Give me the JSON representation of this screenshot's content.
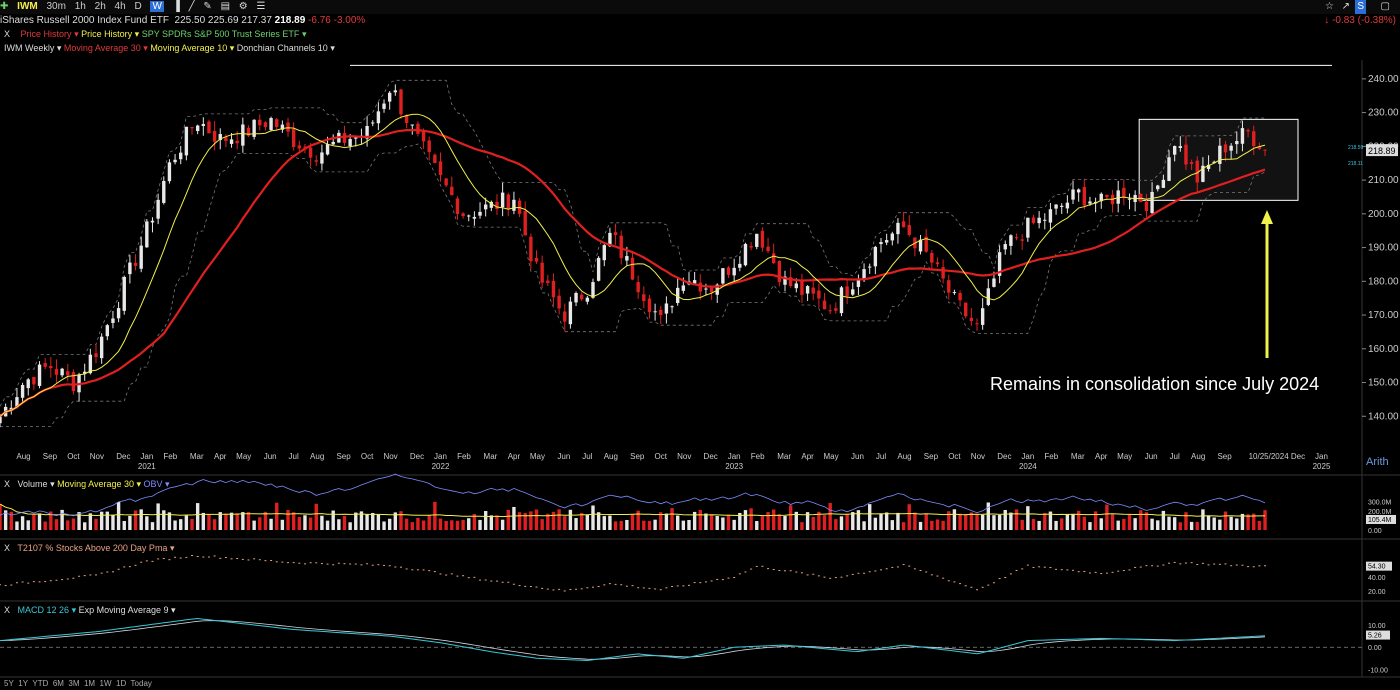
{
  "header": {
    "symbol": "IWM",
    "timeframes": [
      "30m",
      "1h",
      "2h",
      "4h",
      "D",
      "W"
    ],
    "active_timeframe": "W",
    "change_right": "-0.83 (-0.38%)",
    "name": "iShares Russell 2000 Index Fund ETF",
    "open": "225.50",
    "high": "225.69",
    "low": "217.37",
    "close": "218.89",
    "change": "-6.76",
    "change_pct": "-3.00%"
  },
  "overlays_row": {
    "close_x": "X",
    "price_history_1": "Price History",
    "price_history_2": "Price History",
    "compare": "SPY SPDRs S&P 500 Trust Series ETF"
  },
  "studies_row": {
    "weekly": "IWM Weekly",
    "ma30": "Moving Average 30",
    "ma10": "Moving Average 10",
    "donchian": "Donchian Channels 10"
  },
  "annotation": "Remains in consolidation since July 2024",
  "volume_pane": {
    "close_x": "X",
    "label": "Volume",
    "ma": "Moving Average 30",
    "obv": "OBV",
    "ticks": [
      "300.0M",
      "200.0M",
      "0.00"
    ],
    "last": "105.4M"
  },
  "breadth_pane": {
    "close_x": "X",
    "label": "T2107 % Stocks Above 200 Day Pma",
    "ticks": [
      "40.00",
      "20.00"
    ],
    "last": "54.30"
  },
  "macd_pane": {
    "close_x": "X",
    "label": "MACD 12 26",
    "signal": "Exp Moving Average 9",
    "ticks": [
      "10.00",
      "0.00",
      "-10.00"
    ],
    "last": "5.26"
  },
  "footer": {
    "ranges": [
      "5Y",
      "1Y",
      "YTD",
      "6M",
      "3M",
      "1M",
      "1W",
      "1D",
      "Today"
    ]
  },
  "scale_mode": "Arith",
  "colors": {
    "up": "#e8e8e8",
    "down": "#e02020",
    "ma30": "#e02020",
    "ma10": "#f2f04a",
    "donchian": "#777777",
    "obv": "#7d8cff",
    "breadth": "#e8a080",
    "macd": "#38c8d8",
    "signal": "#cfd8e0",
    "annotation_arrow": "#f2f04a"
  },
  "chart_data": [
    {
      "type": "candlestick",
      "series_name": "IWM Weekly",
      "ylim": [
        130,
        245
      ],
      "y_ticks": [
        140,
        150,
        160,
        170,
        180,
        190,
        200,
        210,
        220,
        230,
        240
      ],
      "x_labels": [
        {
          "label": "Aug",
          "year": "",
          "t": 2020.58
        },
        {
          "label": "Sep",
          "year": "",
          "t": 2020.67
        },
        {
          "label": "Oct",
          "year": "",
          "t": 2020.75
        },
        {
          "label": "Nov",
          "year": "",
          "t": 2020.83
        },
        {
          "label": "Dec",
          "year": "",
          "t": 2020.92
        },
        {
          "label": "Jan",
          "year": "2021",
          "t": 2021.0
        },
        {
          "label": "Feb",
          "year": "",
          "t": 2021.08
        },
        {
          "label": "Mar",
          "year": "",
          "t": 2021.17
        },
        {
          "label": "Apr",
          "year": "",
          "t": 2021.25
        },
        {
          "label": "May",
          "year": "",
          "t": 2021.33
        },
        {
          "label": "Jun",
          "year": "",
          "t": 2021.42
        },
        {
          "label": "Jul",
          "year": "",
          "t": 2021.5
        },
        {
          "label": "Aug",
          "year": "",
          "t": 2021.58
        },
        {
          "label": "Sep",
          "year": "",
          "t": 2021.67
        },
        {
          "label": "Oct",
          "year": "",
          "t": 2021.75
        },
        {
          "label": "Nov",
          "year": "",
          "t": 2021.83
        },
        {
          "label": "Dec",
          "year": "",
          "t": 2021.92
        },
        {
          "label": "Jan",
          "year": "2022",
          "t": 2022.0
        },
        {
          "label": "Feb",
          "year": "",
          "t": 2022.08
        },
        {
          "label": "Mar",
          "year": "",
          "t": 2022.17
        },
        {
          "label": "Apr",
          "year": "",
          "t": 2022.25
        },
        {
          "label": "May",
          "year": "",
          "t": 2022.33
        },
        {
          "label": "Jun",
          "year": "",
          "t": 2022.42
        },
        {
          "label": "Jul",
          "year": "",
          "t": 2022.5
        },
        {
          "label": "Aug",
          "year": "",
          "t": 2022.58
        },
        {
          "label": "Sep",
          "year": "",
          "t": 2022.67
        },
        {
          "label": "Oct",
          "year": "",
          "t": 2022.75
        },
        {
          "label": "Nov",
          "year": "",
          "t": 2022.83
        },
        {
          "label": "Dec",
          "year": "",
          "t": 2022.92
        },
        {
          "label": "Jan",
          "year": "2023",
          "t": 2023.0
        },
        {
          "label": "Feb",
          "year": "",
          "t": 2023.08
        },
        {
          "label": "Mar",
          "year": "",
          "t": 2023.17
        },
        {
          "label": "Apr",
          "year": "",
          "t": 2023.25
        },
        {
          "label": "May",
          "year": "",
          "t": 2023.33
        },
        {
          "label": "Jun",
          "year": "",
          "t": 2023.42
        },
        {
          "label": "Jul",
          "year": "",
          "t": 2023.5
        },
        {
          "label": "Aug",
          "year": "",
          "t": 2023.58
        },
        {
          "label": "Sep",
          "year": "",
          "t": 2023.67
        },
        {
          "label": "Oct",
          "year": "",
          "t": 2023.75
        },
        {
          "label": "Nov",
          "year": "",
          "t": 2023.83
        },
        {
          "label": "Dec",
          "year": "",
          "t": 2023.92
        },
        {
          "label": "Jan",
          "year": "2024",
          "t": 2024.0
        },
        {
          "label": "Feb",
          "year": "",
          "t": 2024.08
        },
        {
          "label": "Mar",
          "year": "",
          "t": 2024.17
        },
        {
          "label": "Apr",
          "year": "",
          "t": 2024.25
        },
        {
          "label": "May",
          "year": "",
          "t": 2024.33
        },
        {
          "label": "Jun",
          "year": "",
          "t": 2024.42
        },
        {
          "label": "Jul",
          "year": "",
          "t": 2024.5
        },
        {
          "label": "Aug",
          "year": "",
          "t": 2024.58
        },
        {
          "label": "Sep",
          "year": "",
          "t": 2024.67
        },
        {
          "label": "10/25/2024",
          "year": "",
          "t": 2024.82
        },
        {
          "label": "Dec",
          "year": "",
          "t": 2024.92
        },
        {
          "label": "Jan",
          "year": "2025",
          "t": 2025.0
        }
      ],
      "key_points": [
        {
          "t": 2020.5,
          "p": 140
        },
        {
          "t": 2020.58,
          "p": 150
        },
        {
          "t": 2020.67,
          "p": 155
        },
        {
          "t": 2020.75,
          "p": 150
        },
        {
          "t": 2020.83,
          "p": 160
        },
        {
          "t": 2020.92,
          "p": 178
        },
        {
          "t": 2021.0,
          "p": 195
        },
        {
          "t": 2021.08,
          "p": 215
        },
        {
          "t": 2021.17,
          "p": 228
        },
        {
          "t": 2021.25,
          "p": 222
        },
        {
          "t": 2021.33,
          "p": 224
        },
        {
          "t": 2021.42,
          "p": 228
        },
        {
          "t": 2021.5,
          "p": 222
        },
        {
          "t": 2021.58,
          "p": 218
        },
        {
          "t": 2021.67,
          "p": 222
        },
        {
          "t": 2021.75,
          "p": 224
        },
        {
          "t": 2021.83,
          "p": 238
        },
        {
          "t": 2021.92,
          "p": 222
        },
        {
          "t": 2022.0,
          "p": 210
        },
        {
          "t": 2022.08,
          "p": 200
        },
        {
          "t": 2022.17,
          "p": 202
        },
        {
          "t": 2022.25,
          "p": 205
        },
        {
          "t": 2022.33,
          "p": 182
        },
        {
          "t": 2022.42,
          "p": 170
        },
        {
          "t": 2022.5,
          "p": 178
        },
        {
          "t": 2022.58,
          "p": 194
        },
        {
          "t": 2022.67,
          "p": 180
        },
        {
          "t": 2022.75,
          "p": 168
        },
        {
          "t": 2022.83,
          "p": 182
        },
        {
          "t": 2022.92,
          "p": 178
        },
        {
          "t": 2023.0,
          "p": 186
        },
        {
          "t": 2023.08,
          "p": 195
        },
        {
          "t": 2023.17,
          "p": 180
        },
        {
          "t": 2023.25,
          "p": 176
        },
        {
          "t": 2023.33,
          "p": 172
        },
        {
          "t": 2023.42,
          "p": 182
        },
        {
          "t": 2023.5,
          "p": 192
        },
        {
          "t": 2023.58,
          "p": 196
        },
        {
          "t": 2023.67,
          "p": 186
        },
        {
          "t": 2023.75,
          "p": 174
        },
        {
          "t": 2023.83,
          "p": 166
        },
        {
          "t": 2023.92,
          "p": 190
        },
        {
          "t": 2024.0,
          "p": 196
        },
        {
          "t": 2024.08,
          "p": 200
        },
        {
          "t": 2024.17,
          "p": 206
        },
        {
          "t": 2024.25,
          "p": 203
        },
        {
          "t": 2024.33,
          "p": 207
        },
        {
          "t": 2024.42,
          "p": 203
        },
        {
          "t": 2024.5,
          "p": 222
        },
        {
          "t": 2024.58,
          "p": 210
        },
        {
          "t": 2024.67,
          "p": 220
        },
        {
          "t": 2024.75,
          "p": 224
        },
        {
          "t": 2024.82,
          "p": 218.89
        }
      ],
      "ma30_last": 210,
      "ma10_last": 218.11,
      "resistance_high": 244,
      "consolidation_box": {
        "t_start": 2024.42,
        "t_end": 2024.92,
        "p_low": 204,
        "p_high": 228
      },
      "price_labels": {
        "last": "218.89",
        "ma10": "218.11",
        "ma30": "218.59"
      }
    },
    {
      "type": "bar",
      "series_name": "Volume",
      "ylim": [
        0,
        400
      ],
      "unit": "M",
      "note": "weekly volume bars with 30-period moving average and OBV line"
    },
    {
      "type": "line",
      "series_name": "T2107 % Stocks Above 200 Day Pma",
      "ylim": [
        10,
        75
      ],
      "key_points": [
        {
          "t": 2020.5,
          "p": 28
        },
        {
          "t": 2020.83,
          "p": 42
        },
        {
          "t": 2021.0,
          "p": 62
        },
        {
          "t": 2021.17,
          "p": 70
        },
        {
          "t": 2021.5,
          "p": 60
        },
        {
          "t": 2021.83,
          "p": 56
        },
        {
          "t": 2022.08,
          "p": 40
        },
        {
          "t": 2022.42,
          "p": 20
        },
        {
          "t": 2022.58,
          "p": 30
        },
        {
          "t": 2022.75,
          "p": 22
        },
        {
          "t": 2023.0,
          "p": 40
        },
        {
          "t": 2023.08,
          "p": 55
        },
        {
          "t": 2023.33,
          "p": 38
        },
        {
          "t": 2023.58,
          "p": 56
        },
        {
          "t": 2023.83,
          "p": 22
        },
        {
          "t": 2024.0,
          "p": 55
        },
        {
          "t": 2024.25,
          "p": 45
        },
        {
          "t": 2024.5,
          "p": 60
        },
        {
          "t": 2024.82,
          "p": 54.3
        }
      ]
    },
    {
      "type": "line",
      "series_name": "MACD 12 26",
      "ylim": [
        -13,
        15
      ],
      "key_points": [
        {
          "t": 2020.5,
          "p": 3
        },
        {
          "t": 2020.83,
          "p": 7
        },
        {
          "t": 2021.0,
          "p": 10
        },
        {
          "t": 2021.17,
          "p": 13
        },
        {
          "t": 2021.5,
          "p": 8
        },
        {
          "t": 2021.83,
          "p": 5
        },
        {
          "t": 2022.0,
          "p": 2
        },
        {
          "t": 2022.17,
          "p": -2
        },
        {
          "t": 2022.33,
          "p": -5
        },
        {
          "t": 2022.5,
          "p": -6
        },
        {
          "t": 2022.67,
          "p": -3
        },
        {
          "t": 2022.83,
          "p": -5
        },
        {
          "t": 2023.0,
          "p": 0
        },
        {
          "t": 2023.17,
          "p": 1
        },
        {
          "t": 2023.42,
          "p": -2
        },
        {
          "t": 2023.58,
          "p": 1
        },
        {
          "t": 2023.83,
          "p": -3
        },
        {
          "t": 2024.0,
          "p": 3
        },
        {
          "t": 2024.25,
          "p": 4
        },
        {
          "t": 2024.5,
          "p": 3
        },
        {
          "t": 2024.82,
          "p": 5.26
        }
      ],
      "signal_last": 4.5
    }
  ]
}
